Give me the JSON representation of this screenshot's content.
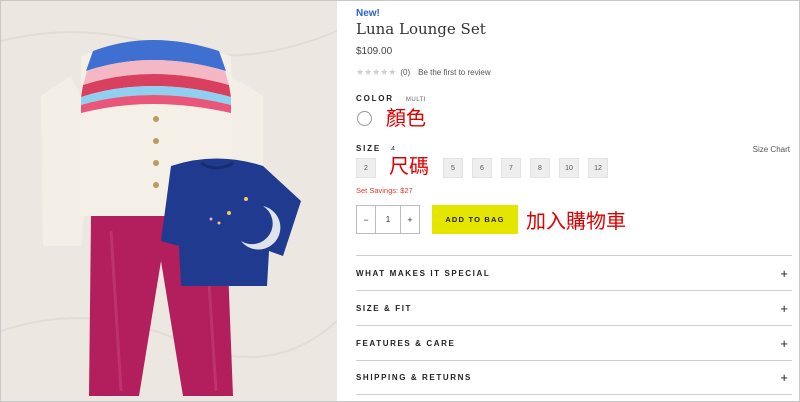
{
  "product": {
    "badge": "New!",
    "title": "Luna Lounge Set",
    "price": "$109.00",
    "rating": {
      "stars_filled": 0,
      "stars_total": 5,
      "count_text": "(0)",
      "review_cta": "Be the first to review"
    }
  },
  "color": {
    "label": "COLOR",
    "selected": "MULTI",
    "annotation": "顏色"
  },
  "size": {
    "label": "SIZE",
    "selected": "4",
    "chart_link": "Size Chart",
    "options": [
      "2",
      "5",
      "6",
      "7",
      "8",
      "10",
      "12"
    ],
    "annotation": "尺碼"
  },
  "savings": "Set Savings: $27",
  "quantity": {
    "minus": "−",
    "value": "1",
    "plus": "+"
  },
  "add_to_bag": {
    "label": "ADD TO BAG",
    "annotation": "加入購物車"
  },
  "accordions": [
    {
      "label": "WHAT MAKES IT SPECIAL",
      "icon": "+"
    },
    {
      "label": "SIZE & FIT",
      "icon": "+"
    },
    {
      "label": "FEATURES & CARE",
      "icon": "+"
    },
    {
      "label": "SHIPPING & RETURNS",
      "icon": "+"
    }
  ],
  "colors": {
    "accent_yellow": "#e4e600",
    "badge_blue": "#2a63c9",
    "savings_red": "#e53a2e",
    "annotation_red": "#e00000"
  }
}
